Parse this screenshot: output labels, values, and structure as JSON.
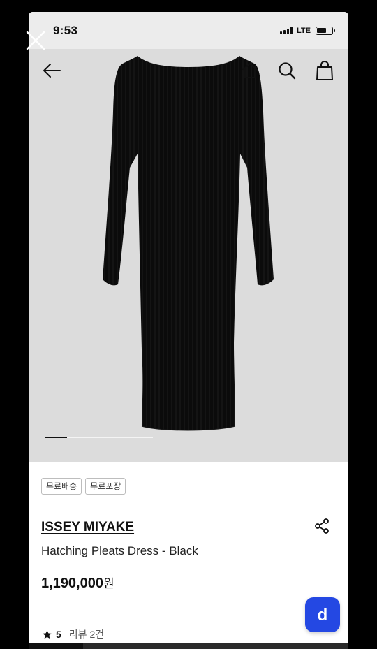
{
  "status_bar": {
    "time": "9:53",
    "network": "LTE",
    "icons": [
      "signal-icon",
      "battery-icon"
    ]
  },
  "overlay": {
    "close_icon": "close-icon"
  },
  "nav": {
    "icons": [
      "back-arrow-icon",
      "home-icon",
      "search-icon",
      "shopping-bag-icon"
    ]
  },
  "gallery": {
    "progress": 0.2
  },
  "product": {
    "tags": [
      "무료배송",
      "무료포장"
    ],
    "brand": "ISSEY MIYAKE",
    "name": "Hatching Pleats Dress - Black",
    "price_number": "1,190,000",
    "price_unit": "원",
    "rating": "5",
    "reviews_label": "리뷰 2건"
  },
  "fab": {
    "icon": "d-logo-icon",
    "letter": "d"
  },
  "colors": {
    "accent": "#2448e3",
    "hero_bg": "#dcdcdc",
    "text": "#111111"
  }
}
